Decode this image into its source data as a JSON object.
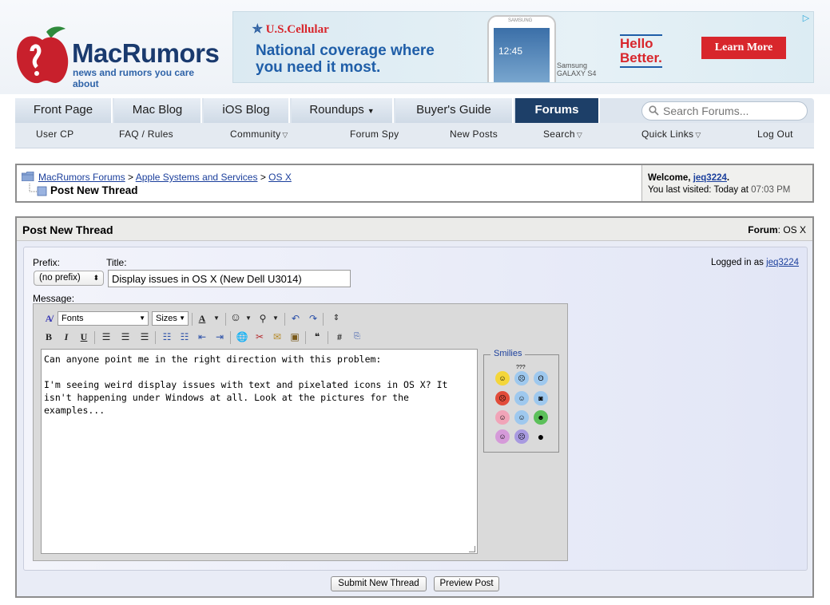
{
  "logo": {
    "name": "MacRumors",
    "tagline": "news and rumors you care about"
  },
  "ad": {
    "brand": "U.S.Cellular",
    "headline_1": "National coverage where",
    "headline_2": "you need it most.",
    "phone_time": "12:45",
    "phone_brand": "SAMSUNG",
    "device_line_1": "Samsung",
    "device_line_2": "GALAXY S4",
    "slogan_1": "Hello",
    "slogan_2": "Better.",
    "cta": "Learn More"
  },
  "nav": {
    "tabs": [
      {
        "label": "Front Page"
      },
      {
        "label": "Mac Blog"
      },
      {
        "label": "iOS Blog"
      },
      {
        "label": "Roundups"
      },
      {
        "label": "Buyer's Guide"
      },
      {
        "label": "Forums"
      }
    ],
    "search_placeholder": "Search Forums..."
  },
  "subnav": [
    {
      "label": "User CP"
    },
    {
      "label": "FAQ / Rules"
    },
    {
      "label": "Community"
    },
    {
      "label": "Forum Spy"
    },
    {
      "label": "New Posts"
    },
    {
      "label": "Search"
    },
    {
      "label": "Quick Links"
    },
    {
      "label": "Log Out"
    }
  ],
  "breadcrumb": {
    "links": [
      "MacRumors Forums",
      "Apple Systems and Services",
      "OS X"
    ],
    "separator": ">",
    "current": "Post New Thread"
  },
  "welcome": {
    "label": "Welcome,",
    "user": "jeq3224",
    "suffix": ".",
    "visited_label": "You last visited: Today at",
    "visited_time": "07:03 PM"
  },
  "post": {
    "header_title": "Post New Thread",
    "forum_label": "Forum",
    "forum_sep": ":",
    "forum_name": "OS X",
    "prefix_label": "Prefix:",
    "prefix_value": "(no prefix)",
    "title_label": "Title:",
    "title_value": "Display issues in OS X (New Dell U3014)",
    "logged_in_label": "Logged in as",
    "logged_in_user": "jeq3224",
    "message_label": "Message:",
    "message_text": "Can anyone point me in the right direction with this problem:\n\nI'm seeing weird display issues with text and pixelated icons in OS X? It isn't happening under Windows at all. Look at the pictures for the examples..."
  },
  "editor": {
    "font_select": "Fonts",
    "size_select": "Sizes",
    "bold": "B",
    "italic": "I",
    "underline": "U",
    "hash": "#"
  },
  "smilies": {
    "label": "Smilies",
    "confused_text": "???"
  },
  "buttons": {
    "submit": "Submit New Thread",
    "preview": "Preview Post"
  },
  "colors": {
    "brand_navy": "#1d3f68",
    "link_blue": "#1b3f9c",
    "ad_red": "#d8262c",
    "ad_blue": "#1f5ea8"
  }
}
